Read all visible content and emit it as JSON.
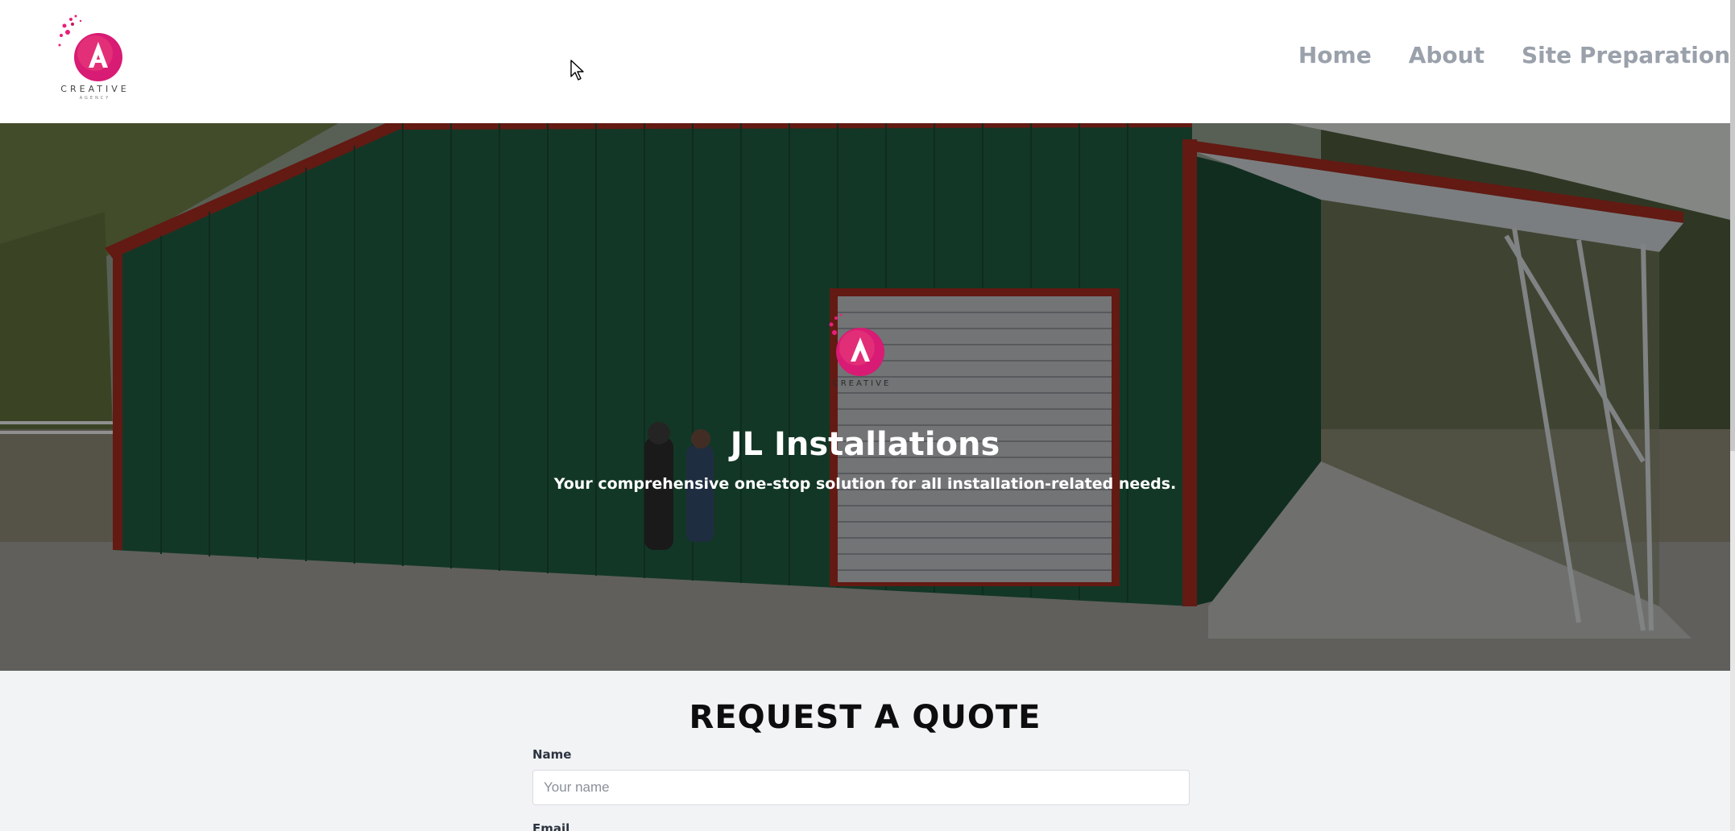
{
  "header": {
    "logo": {
      "icon": "creative-agency-logo-icon",
      "text": "CREATIVE",
      "subtext": "AGENCY"
    },
    "nav": [
      {
        "label": "Home"
      },
      {
        "label": "About"
      },
      {
        "label": "Site Preparation"
      }
    ]
  },
  "hero": {
    "title": "JL Installations",
    "subtitle": "Your comprehensive one-stop solution for all installation-related needs.",
    "logo_text": "CREATIVE"
  },
  "quote": {
    "title": "REQUEST A QUOTE",
    "name_label": "Name",
    "name_placeholder": "Your name",
    "email_label": "Email"
  },
  "colors": {
    "brand_pink": "#e91e7a",
    "nav_text": "#9aa1ab",
    "barn_green": "#1f5a3e",
    "trim_red": "#9e2a1f"
  }
}
